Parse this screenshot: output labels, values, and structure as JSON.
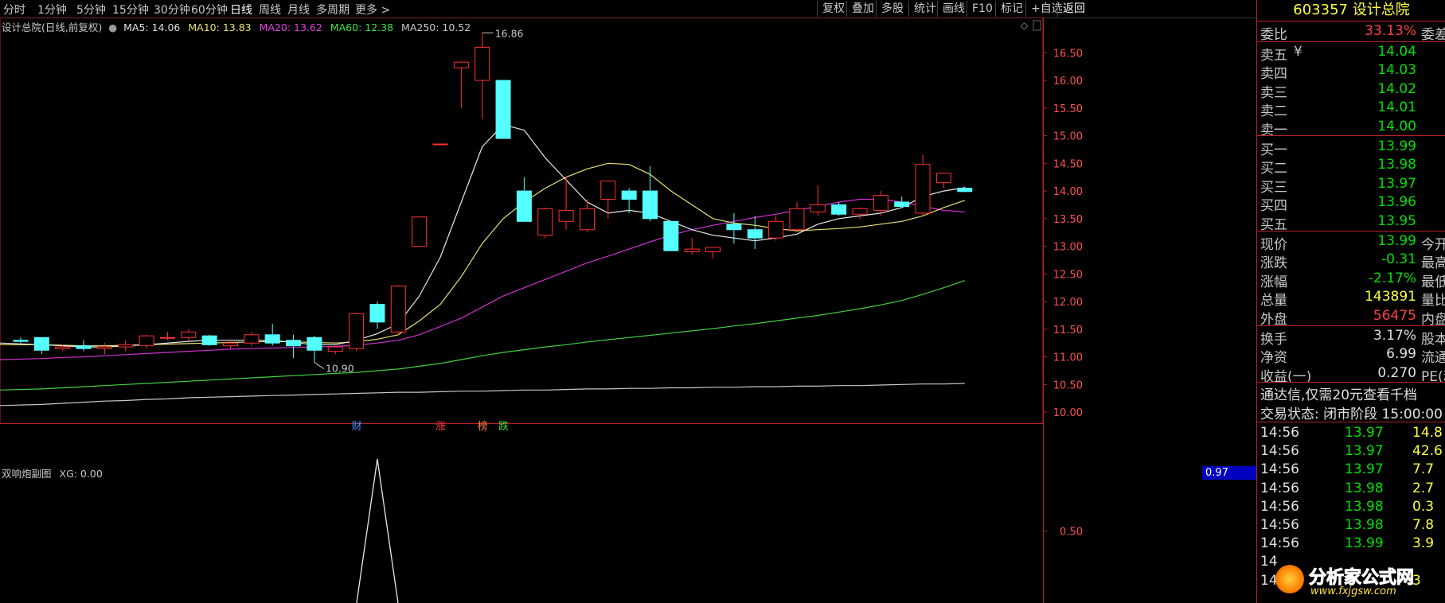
{
  "toolbar": {
    "periods": [
      "分时",
      "1分钟",
      "5分钟",
      "15分钟",
      "30分钟",
      "60分钟",
      "日线",
      "周线",
      "月线",
      "多周期",
      "更多 >"
    ],
    "buttons": [
      "复权",
      "叠加",
      "多股",
      "统计",
      "画线",
      "F10",
      "标记",
      "+自选",
      "返回"
    ]
  },
  "header": {
    "title": "设计总院(日线,前复权)",
    "ma": [
      {
        "label": "MA5: 14.06",
        "color": "#e0e0e0"
      },
      {
        "label": "MA10: 13.83",
        "color": "#e8e070"
      },
      {
        "label": "MA20: 13.62",
        "color": "#e040e0"
      },
      {
        "label": "MA60: 12.38",
        "color": "#40e040"
      },
      {
        "label": "MA250: 10.52",
        "color": "#c8c8c8"
      }
    ]
  },
  "indicator": {
    "title": "双响炮副图",
    "xg": "XG: 0.00",
    "current": "0.97"
  },
  "chart_data": {
    "type": "candlestick",
    "ylim": [
      9.8,
      16.85
    ],
    "yticks": [
      "16.50",
      "16.00",
      "15.50",
      "15.00",
      "14.50",
      "14.00",
      "13.50",
      "13.00",
      "12.50",
      "12.00",
      "11.50",
      "11.00",
      "10.50",
      "10.00"
    ],
    "candles": [
      {
        "o": 11.3,
        "h": 11.35,
        "l": 11.25,
        "c": 11.28
      },
      {
        "o": 11.35,
        "h": 11.35,
        "l": 11.05,
        "c": 11.12
      },
      {
        "o": 11.15,
        "h": 11.22,
        "l": 11.1,
        "c": 11.18
      },
      {
        "o": 11.2,
        "h": 11.3,
        "l": 11.1,
        "c": 11.15
      },
      {
        "o": 11.15,
        "h": 11.25,
        "l": 11.05,
        "c": 11.18
      },
      {
        "o": 11.18,
        "h": 11.3,
        "l": 11.1,
        "c": 11.22
      },
      {
        "o": 11.2,
        "h": 11.4,
        "l": 11.15,
        "c": 11.38
      },
      {
        "o": 11.35,
        "h": 11.45,
        "l": 11.3,
        "c": 11.35
      },
      {
        "o": 11.35,
        "h": 11.5,
        "l": 11.3,
        "c": 11.45
      },
      {
        "o": 11.38,
        "h": 11.4,
        "l": 11.2,
        "c": 11.22
      },
      {
        "o": 11.2,
        "h": 11.28,
        "l": 11.15,
        "c": 11.25
      },
      {
        "o": 11.25,
        "h": 11.45,
        "l": 11.2,
        "c": 11.4
      },
      {
        "o": 11.4,
        "h": 11.6,
        "l": 11.2,
        "c": 11.25
      },
      {
        "o": 11.3,
        "h": 11.4,
        "l": 10.98,
        "c": 11.2
      },
      {
        "o": 11.35,
        "h": 11.38,
        "l": 10.9,
        "c": 11.12
      },
      {
        "o": 11.1,
        "h": 11.2,
        "l": 11.05,
        "c": 11.18
      },
      {
        "o": 11.15,
        "h": 11.8,
        "l": 11.1,
        "c": 11.78
      },
      {
        "o": 11.95,
        "h": 12.0,
        "l": 11.5,
        "c": 11.63
      },
      {
        "o": 11.45,
        "h": 12.3,
        "l": 11.4,
        "c": 12.28
      },
      {
        "o": 13.0,
        "h": 13.53,
        "l": 13.0,
        "c": 13.53
      },
      {
        "o": 14.85,
        "h": 14.85,
        "l": 14.85,
        "c": 14.85
      },
      {
        "o": 16.23,
        "h": 16.35,
        "l": 15.5,
        "c": 16.33
      },
      {
        "o": 16.0,
        "h": 16.86,
        "l": 15.3,
        "c": 16.6
      },
      {
        "o": 16.0,
        "h": 16.0,
        "l": 14.95,
        "c": 14.95
      },
      {
        "o": 14.0,
        "h": 14.25,
        "l": 13.45,
        "c": 13.45
      },
      {
        "o": 13.2,
        "h": 13.7,
        "l": 13.15,
        "c": 13.68
      },
      {
        "o": 13.45,
        "h": 14.25,
        "l": 13.3,
        "c": 13.65
      },
      {
        "o": 13.3,
        "h": 13.85,
        "l": 13.25,
        "c": 13.68
      },
      {
        "o": 13.85,
        "h": 14.15,
        "l": 13.5,
        "c": 14.18
      },
      {
        "o": 14.0,
        "h": 14.05,
        "l": 13.6,
        "c": 13.85
      },
      {
        "o": 14.0,
        "h": 14.45,
        "l": 13.45,
        "c": 13.5
      },
      {
        "o": 13.45,
        "h": 13.45,
        "l": 12.92,
        "c": 12.92
      },
      {
        "o": 12.9,
        "h": 13.15,
        "l": 12.85,
        "c": 12.95
      },
      {
        "o": 12.9,
        "h": 12.96,
        "l": 12.78,
        "c": 12.98
      },
      {
        "o": 13.4,
        "h": 13.6,
        "l": 13.05,
        "c": 13.3
      },
      {
        "o": 13.3,
        "h": 13.55,
        "l": 12.95,
        "c": 13.15
      },
      {
        "o": 13.15,
        "h": 13.55,
        "l": 13.1,
        "c": 13.45
      },
      {
        "o": 13.3,
        "h": 13.8,
        "l": 13.25,
        "c": 13.68
      },
      {
        "o": 13.62,
        "h": 14.1,
        "l": 13.55,
        "c": 13.75
      },
      {
        "o": 13.75,
        "h": 13.8,
        "l": 13.55,
        "c": 13.58
      },
      {
        "o": 13.58,
        "h": 13.7,
        "l": 13.5,
        "c": 13.68
      },
      {
        "o": 13.65,
        "h": 14.0,
        "l": 13.55,
        "c": 13.92
      },
      {
        "o": 13.8,
        "h": 13.9,
        "l": 13.7,
        "c": 13.72
      },
      {
        "o": 13.6,
        "h": 14.65,
        "l": 13.55,
        "c": 14.48
      },
      {
        "o": 14.15,
        "h": 14.3,
        "l": 14.05,
        "c": 14.32
      },
      {
        "o": 14.05,
        "h": 14.08,
        "l": 13.98,
        "c": 13.99
      }
    ],
    "ma5": [
      11.25,
      11.22,
      11.2,
      11.18,
      11.18,
      11.2,
      11.22,
      11.25,
      11.28,
      11.3,
      11.3,
      11.3,
      11.3,
      11.26,
      11.22,
      11.22,
      11.3,
      11.42,
      11.6,
      12.1,
      12.8,
      13.8,
      14.8,
      15.2,
      15.1,
      14.6,
      14.2,
      13.8,
      13.6,
      13.65,
      13.6,
      13.45,
      13.3,
      13.2,
      13.15,
      13.1,
      13.15,
      13.22,
      13.4,
      13.5,
      13.55,
      13.6,
      13.7,
      13.9,
      14.0,
      14.06
    ],
    "ma10": [
      11.22,
      11.22,
      11.21,
      11.2,
      11.2,
      11.21,
      11.22,
      11.23,
      11.24,
      11.25,
      11.26,
      11.27,
      11.28,
      11.27,
      11.26,
      11.25,
      11.27,
      11.32,
      11.4,
      11.65,
      11.95,
      12.45,
      13.05,
      13.5,
      13.8,
      14.05,
      14.25,
      14.4,
      14.5,
      14.48,
      14.3,
      14.0,
      13.75,
      13.5,
      13.42,
      13.38,
      13.32,
      13.28,
      13.3,
      13.32,
      13.35,
      13.4,
      13.45,
      13.55,
      13.7,
      13.83
    ],
    "ma20": [
      10.95,
      10.97,
      10.99,
      11.0,
      11.02,
      11.04,
      11.06,
      11.08,
      11.1,
      11.12,
      11.14,
      11.15,
      11.16,
      11.17,
      11.18,
      11.19,
      11.21,
      11.25,
      11.3,
      11.4,
      11.55,
      11.7,
      11.9,
      12.1,
      12.25,
      12.4,
      12.55,
      12.7,
      12.82,
      12.95,
      13.08,
      13.2,
      13.3,
      13.38,
      13.45,
      13.52,
      13.58,
      13.65,
      13.72,
      13.8,
      13.85,
      13.85,
      13.8,
      13.72,
      13.65,
      13.62
    ],
    "ma60": [
      10.4,
      10.42,
      10.44,
      10.46,
      10.48,
      10.5,
      10.52,
      10.54,
      10.56,
      10.58,
      10.6,
      10.62,
      10.64,
      10.66,
      10.68,
      10.7,
      10.72,
      10.75,
      10.78,
      10.83,
      10.88,
      10.95,
      11.02,
      11.08,
      11.13,
      11.18,
      11.22,
      11.27,
      11.31,
      11.35,
      11.39,
      11.43,
      11.47,
      11.51,
      11.56,
      11.6,
      11.65,
      11.7,
      11.75,
      11.81,
      11.87,
      11.94,
      12.02,
      12.13,
      12.25,
      12.38
    ],
    "ma250": [
      10.12,
      10.14,
      10.16,
      10.18,
      10.2,
      10.21,
      10.23,
      10.24,
      10.26,
      10.27,
      10.28,
      10.29,
      10.3,
      10.31,
      10.32,
      10.33,
      10.34,
      10.35,
      10.36,
      10.36,
      10.37,
      10.38,
      10.38,
      10.39,
      10.4,
      10.4,
      10.41,
      10.42,
      10.42,
      10.43,
      10.43,
      10.44,
      10.44,
      10.45,
      10.45,
      10.46,
      10.46,
      10.47,
      10.47,
      10.48,
      10.48,
      10.49,
      10.5,
      10.51,
      10.51,
      10.52
    ],
    "annotations": {
      "high": "16.86",
      "low": "10.90"
    },
    "events": [
      {
        "index": 16,
        "text": "财",
        "color": "#4090ff"
      },
      {
        "index": 20,
        "text": "涨",
        "color": "#ff4040"
      },
      {
        "index": 22,
        "text": "榜",
        "color": "#ff8040"
      },
      {
        "index": 23,
        "text": "跌",
        "color": "#40e040"
      }
    ],
    "indicator": {
      "ylim": [
        0,
        1
      ],
      "yticks": [
        "0.50"
      ],
      "peak_index": 17
    }
  },
  "panel": {
    "code_name": "603357 设计总院",
    "weibi": {
      "label": "委比",
      "value": "33.13%",
      "ext": "委差"
    },
    "sells": [
      {
        "label": "卖五",
        "value": "14.04"
      },
      {
        "label": "卖四",
        "value": "14.03"
      },
      {
        "label": "卖三",
        "value": "14.02"
      },
      {
        "label": "卖二",
        "value": "14.01"
      },
      {
        "label": "卖一",
        "value": "14.00"
      }
    ],
    "sell_marker": "¥",
    "buys": [
      {
        "label": "买一",
        "value": "13.99"
      },
      {
        "label": "买二",
        "value": "13.98"
      },
      {
        "label": "买三",
        "value": "13.97"
      },
      {
        "label": "买四",
        "value": "13.96"
      },
      {
        "label": "买五",
        "value": "13.95"
      }
    ],
    "quote": [
      {
        "label": "现价",
        "value": "13.99",
        "ext": "今开",
        "cls": "green"
      },
      {
        "label": "涨跌",
        "value": "-0.31",
        "ext": "最高",
        "cls": "green"
      },
      {
        "label": "涨幅",
        "value": "-2.17%",
        "ext": "最低",
        "cls": "green"
      },
      {
        "label": "总量",
        "value": "143891",
        "ext": "量比",
        "cls": "yellow"
      },
      {
        "label": "外盘",
        "value": "56475",
        "ext": "内盘",
        "cls": "red"
      }
    ],
    "fund": [
      {
        "label": "换手",
        "value": "3.17%",
        "ext": "股本"
      },
      {
        "label": "净资",
        "value": "6.99",
        "ext": "流通"
      },
      {
        "label": "收益(一)",
        "value": "0.270",
        "ext": "PE(动)"
      }
    ],
    "notice": "通达信,仅需20元查看千档",
    "status": "交易状态: 闭市阶段 15:00:00",
    "ticks": [
      {
        "t": "14:56",
        "p": "13.97",
        "v": "14.8"
      },
      {
        "t": "14:56",
        "p": "13.97",
        "v": "42.6"
      },
      {
        "t": "14:56",
        "p": "13.97",
        "v": "7.7"
      },
      {
        "t": "14:56",
        "p": "13.98",
        "v": "2.7"
      },
      {
        "t": "14:56",
        "p": "13.98",
        "v": "0.3"
      },
      {
        "t": "14:56",
        "p": "13.98",
        "v": "7.8"
      },
      {
        "t": "14:56",
        "p": "13.99",
        "v": "3.9"
      },
      {
        "t": "14",
        "p": "",
        "v": ""
      },
      {
        "t": "14",
        "p": "",
        "v": "3"
      }
    ]
  },
  "watermark": {
    "name": "分析家公式网",
    "url": "www.fxjgsw.com"
  }
}
